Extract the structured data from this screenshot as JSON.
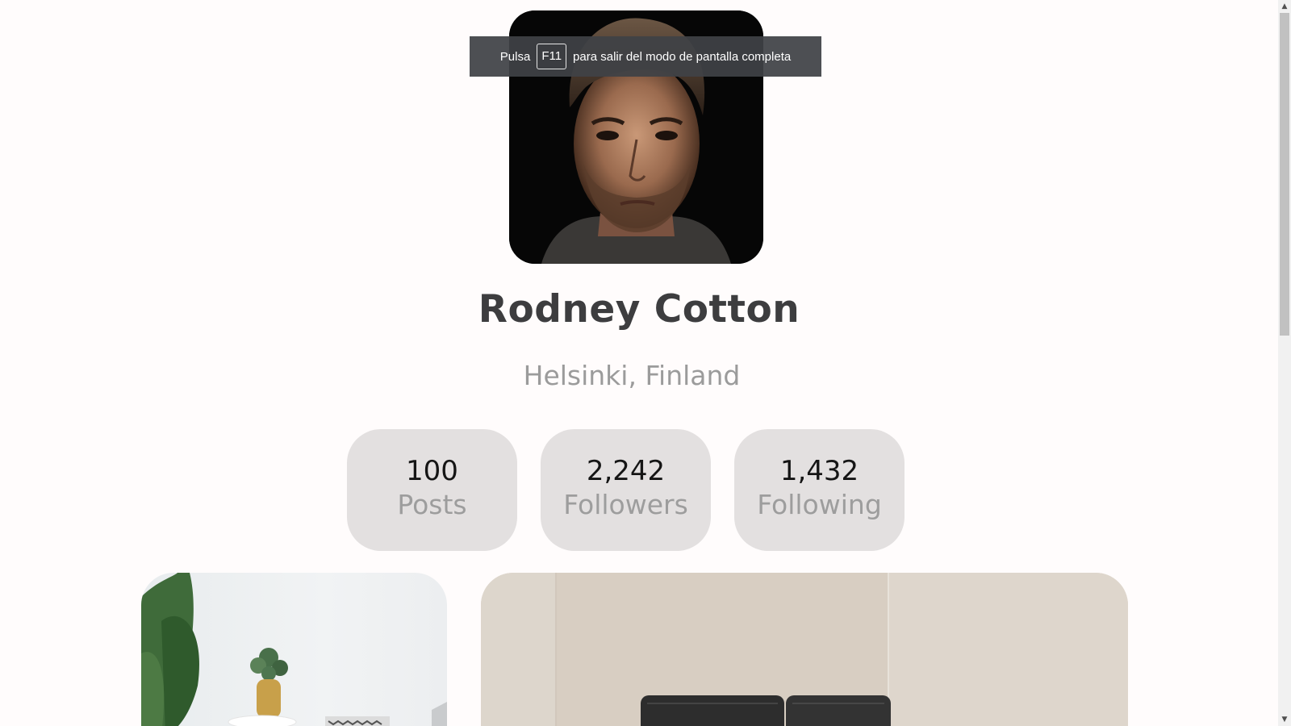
{
  "profile": {
    "name": "Rodney Cotton",
    "location": "Helsinki, Finland",
    "avatar_alt": "Profile photo"
  },
  "stats": [
    {
      "value": "100",
      "label": "Posts"
    },
    {
      "value": "2,242",
      "label": "Followers"
    },
    {
      "value": "1,432",
      "label": "Following"
    }
  ],
  "gallery": {
    "photos": [
      "living room with plant",
      "bedroom with dark headboard"
    ]
  },
  "fullscreen_notice": {
    "prefix": "Pulsa",
    "key": "F11",
    "suffix": "para salir del modo de pantalla completa"
  },
  "icons": {
    "scroll_up": "▲",
    "scroll_down": "▼"
  },
  "colors": {
    "background": "#fffcfc",
    "stat_card": "#e3e0e0",
    "name": "#3d3d3f",
    "muted": "#9b9b9b"
  }
}
